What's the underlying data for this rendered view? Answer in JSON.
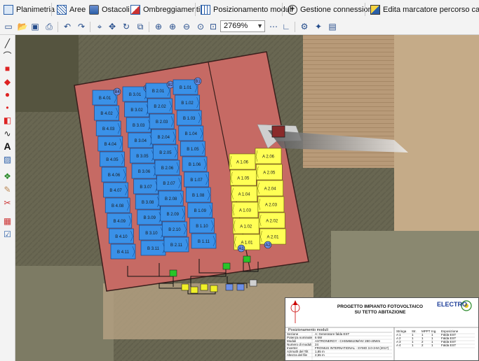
{
  "tabs": [
    {
      "label": "Planimetria",
      "icon": "floorplan-icon"
    },
    {
      "label": "Aree",
      "icon": "areas-grid-icon"
    },
    {
      "label": "Ostacoli",
      "icon": "obstacles-icon"
    },
    {
      "label": "Ombreggiamenti",
      "icon": "shading-icon"
    },
    {
      "label": "Posizionamento moduli",
      "icon": "modules-grid-icon"
    },
    {
      "label": "Gestione connessioni",
      "icon": "connections-plus-icon"
    },
    {
      "label": "Edita marcatore percorso cavi",
      "icon": "cable-marker-icon"
    }
  ],
  "toolbar": {
    "zoom_value": "2769%"
  },
  "modules_b_col1": [
    "B 4.01",
    "B 4.02",
    "B 4.03",
    "B 4.04",
    "B 4.05",
    "B 4.06",
    "B 4.07",
    "B 4.08",
    "B 4.09",
    "B 4.10",
    "B 4.11"
  ],
  "modules_b_col2": [
    "B 3.01",
    "B 3.02",
    "B 3.03",
    "B 3.04",
    "B 3.05",
    "B 3.06",
    "B 3.07",
    "B 3.08",
    "B 3.09",
    "B 3.10",
    "B 3.11"
  ],
  "modules_b_col3": [
    "B 2.01",
    "B 2.02",
    "B 2.03",
    "B 2.04",
    "B 2.05",
    "B 2.06",
    "B 2.07",
    "B 2.08",
    "B 2.09",
    "B 2.10",
    "B 2.11"
  ],
  "modules_b_col4": [
    "B 1.01",
    "B 1.02",
    "B 1.03",
    "B 1.04",
    "B 1.05",
    "B 1.06",
    "B 1.07",
    "B 1.08",
    "B 1.09",
    "B 1.10",
    "B 1.11"
  ],
  "modules_a_col1": [
    "A 1.06",
    "A 1.05",
    "A 1.04",
    "A 1.03",
    "A 1.02",
    "A 1.01"
  ],
  "modules_a_col2": [
    "A 2.06",
    "A 2.05",
    "A 2.04",
    "A 2.03",
    "A 2.02",
    "A 2.01"
  ],
  "string_markers_b": [
    "B4",
    "B3",
    "B2",
    "B1"
  ],
  "string_markers_a": [
    "A1",
    "A2"
  ],
  "title_block": {
    "title_line1": "PROGETTO IMPIANTO FOTOVOLTAICO",
    "title_line2": "SU TETTO ABITAZIONE",
    "logo": "ELECTRO",
    "section": "Posizionamento moduli",
    "rows": [
      {
        "k": "Sezione",
        "v": "A: Generatore falda EST"
      },
      {
        "k": "Potenza nominale",
        "v": "6 kW"
      },
      {
        "k": "Moduli",
        "v": "ASTRONERGY - CHSM6610M/HV 280-40Wm"
      },
      {
        "k": "Numero di moduli",
        "v": "24"
      },
      {
        "k": "Inverter",
        "v": "FRONIUS INTERNATIONAL - SYMO 3.0-3-M (2017)"
      },
      {
        "k": "Azimuth del Tilt",
        "v": "1,85 m"
      },
      {
        "k": "Altezza del file",
        "v": "2,55 m"
      }
    ],
    "table_headers": [
      "Stringa",
      "Str.",
      "MPPT",
      "Ing.",
      "Esposizione"
    ],
    "table_rows": [
      [
        "A 1",
        "1",
        "1",
        "1",
        "Falda EST"
      ],
      [
        "A 2",
        "1",
        "1",
        "1",
        "Falda EST"
      ],
      [
        "A 3",
        "1",
        "2",
        "1",
        "Falda EST"
      ],
      [
        "A 4",
        "1",
        "2",
        "1",
        "Falda EST"
      ]
    ]
  },
  "colors": {
    "roof": "#c66a64",
    "module_blue": "#3a91e8",
    "module_yellow": "#ffff55",
    "marker_blue": "#6b8ee8",
    "box_green": "#28c428",
    "box_yellow": "#f0f028"
  }
}
